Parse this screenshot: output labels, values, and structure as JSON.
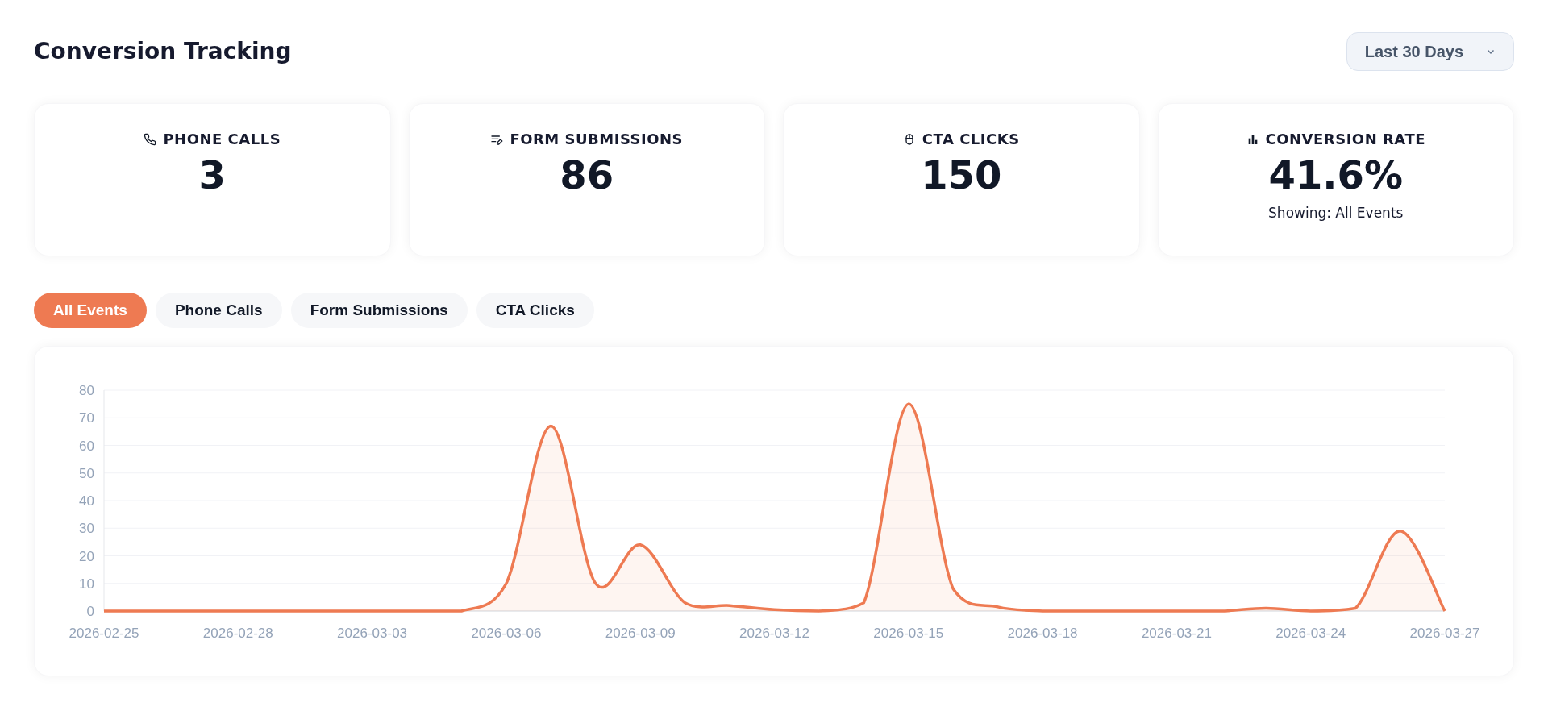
{
  "header": {
    "title": "Conversion Tracking",
    "range_select": {
      "value": "Last 30 Days"
    }
  },
  "stats": [
    {
      "kind": "phone",
      "label": "PHONE CALLS",
      "value": "3"
    },
    {
      "kind": "form",
      "label": "FORM SUBMISSIONS",
      "value": "86"
    },
    {
      "kind": "click",
      "label": "CTA CLICKS",
      "value": "150"
    },
    {
      "kind": "rate",
      "label": "CONVERSION RATE",
      "value": "41.6%",
      "note": "Showing: All Events"
    }
  ],
  "filters": [
    {
      "label": "All Events",
      "selected": true
    },
    {
      "label": "Phone Calls",
      "selected": false
    },
    {
      "label": "Form Submissions",
      "selected": false
    },
    {
      "label": "CTA Clicks",
      "selected": false
    }
  ],
  "chart": {
    "chart_data": {
      "type": "area",
      "categories": [
        "2026-02-25",
        null,
        null,
        "2026-02-28",
        null,
        null,
        "2026-03-03",
        null,
        null,
        "2026-03-06",
        null,
        null,
        "2026-03-09",
        null,
        null,
        "2026-03-12",
        null,
        null,
        "2026-03-15",
        null,
        null,
        "2026-03-18",
        null,
        null,
        "2026-03-21",
        null,
        null,
        "2026-03-24",
        null,
        null,
        "2026-03-27"
      ],
      "series": [
        {
          "color": "#ee7a52",
          "values": [
            0,
            0,
            0,
            0,
            0,
            0,
            0,
            0,
            0,
            10,
            67,
            10,
            24,
            3,
            2,
            0.5,
            0,
            3,
            75,
            8,
            1.5,
            0,
            0,
            0,
            0,
            0,
            1,
            0,
            1,
            29,
            0
          ]
        }
      ],
      "grid": true,
      "ylim": [
        0,
        80
      ],
      "yticks": [
        0,
        10,
        20,
        30,
        40,
        50,
        60,
        70,
        80
      ]
    }
  }
}
